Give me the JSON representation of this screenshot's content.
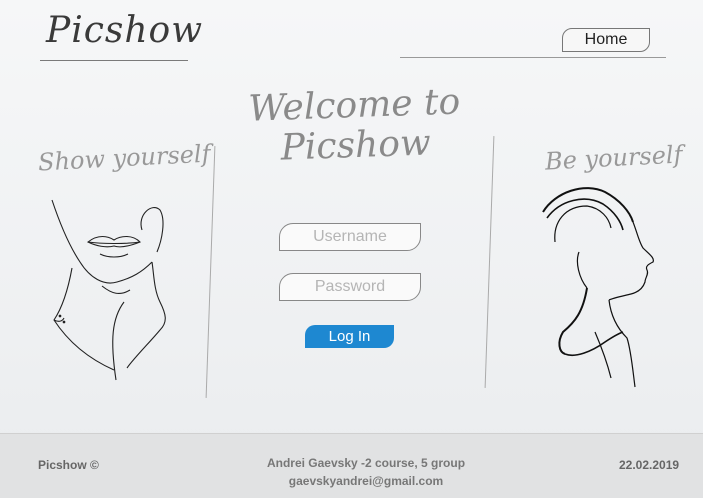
{
  "header": {
    "logo": "Picshow",
    "nav": {
      "home_label": "Home"
    }
  },
  "main": {
    "welcome_line1": "Welcome to",
    "welcome_line2": "Picshow",
    "left_heading": "Show yourself",
    "right_heading": "Be yourself",
    "login_form": {
      "username_placeholder": "Username",
      "password_placeholder": "Password",
      "login_label": "Log In"
    }
  },
  "footer": {
    "brand": "Picshow ©",
    "author": "Andrei Gaevsky -2 course, 5 group",
    "email": "gaevskyandrei@gmail.com",
    "date": "22.02.2019"
  },
  "colors": {
    "accent": "#1e88d1",
    "footer_bg": "#e1e2e3"
  }
}
